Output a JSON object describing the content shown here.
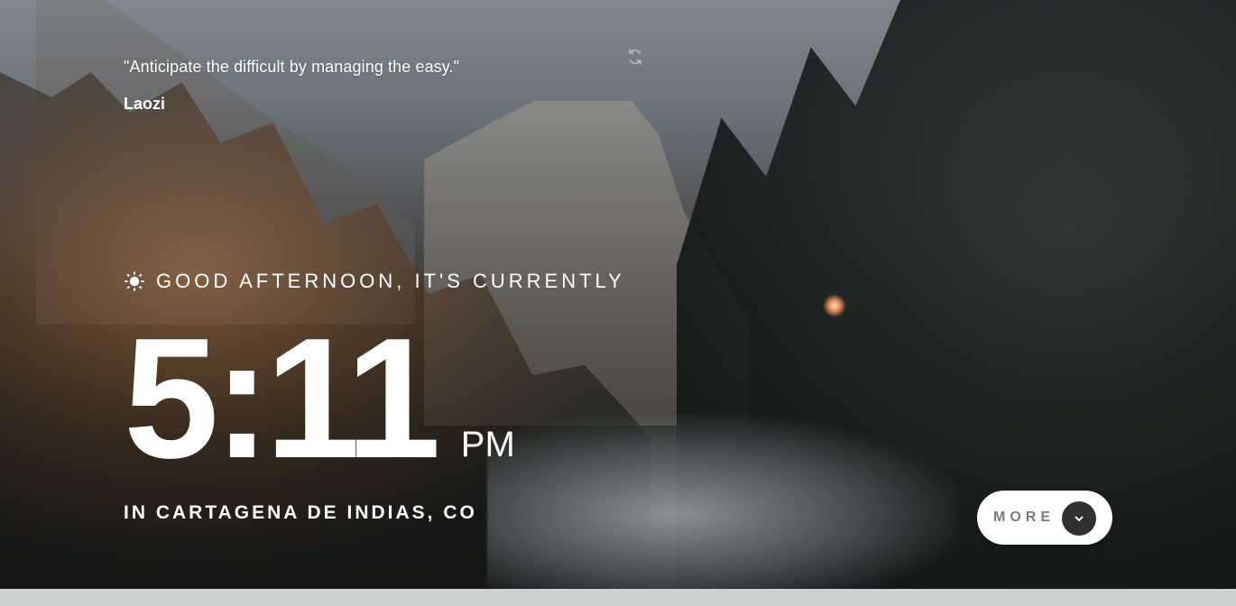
{
  "quote": {
    "text": "\"Anticipate the difficult by managing the easy.\"",
    "author": "Laozi",
    "refresh_icon": "refresh-icon"
  },
  "greeting": {
    "icon": "sun-icon",
    "text": "GOOD AFTERNOON, IT'S CURRENTLY"
  },
  "clock": {
    "time": "5:11",
    "period": "PM"
  },
  "location": {
    "text": "IN CARTAGENA DE INDIAS, CO"
  },
  "more_button": {
    "label": "MORE",
    "icon": "chevron-down-icon"
  },
  "colors": {
    "text": "#FFFFFF",
    "button_bg": "#FFFFFF",
    "button_text": "#7C7C7C",
    "button_circle": "#303030",
    "bottom_bar": "#CDD2CF"
  }
}
